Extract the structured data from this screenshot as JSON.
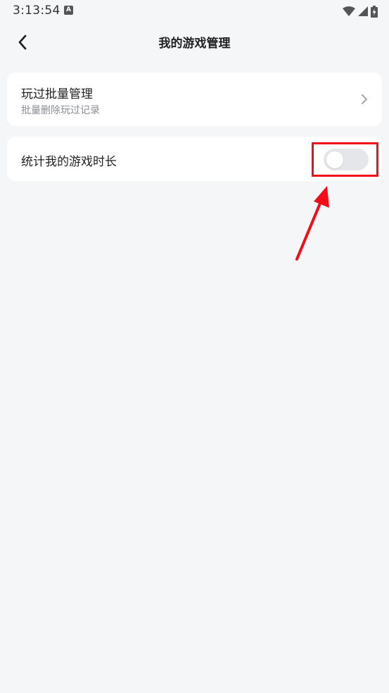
{
  "status_bar": {
    "time": "3:13:54",
    "notification_icon_letter": "A"
  },
  "header": {
    "title": "我的游戏管理"
  },
  "items": {
    "batch_manage": {
      "title": "玩过批量管理",
      "subtitle": "批量删除玩过记录"
    },
    "game_time_stats": {
      "title": "统计我的游戏时长",
      "toggle_on": false
    }
  },
  "colors": {
    "background": "#f5f6f8",
    "card": "#ffffff",
    "toggle_off_track": "#e4e6ea",
    "annotation_red": "#f20d1a"
  },
  "icons": {
    "back": "chevron-left-icon",
    "item_arrow": "chevron-right-icon",
    "wifi": "wifi-icon",
    "signal": "signal-icon",
    "battery": "battery-charging-icon"
  }
}
